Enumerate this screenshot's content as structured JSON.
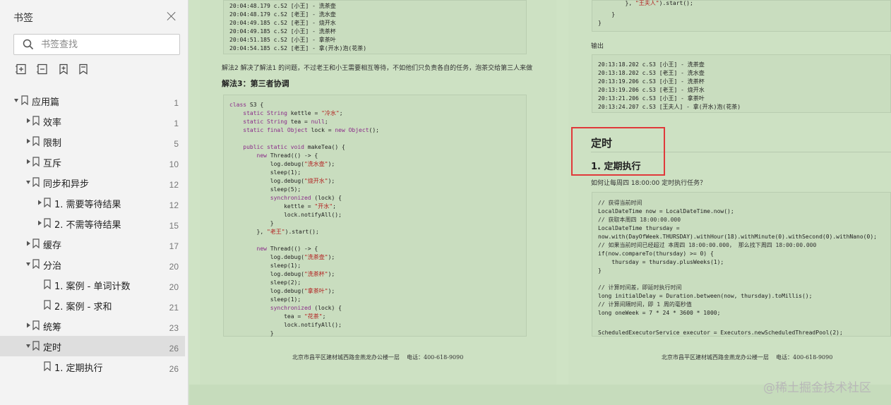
{
  "sidebar": {
    "title": "书签",
    "search_placeholder": "书签查找",
    "items": [
      {
        "label": "应用篇",
        "page": "1"
      },
      {
        "label": "效率",
        "page": "1"
      },
      {
        "label": "限制",
        "page": "5"
      },
      {
        "label": "互斥",
        "page": "10"
      },
      {
        "label": "同步和异步",
        "page": "12"
      },
      {
        "label": "1. 需要等待结果",
        "page": "12"
      },
      {
        "label": "2. 不需等待结果",
        "page": "15"
      },
      {
        "label": "缓存",
        "page": "17"
      },
      {
        "label": "分治",
        "page": "20"
      },
      {
        "label": "1. 案例 - 单词计数",
        "page": "20"
      },
      {
        "label": "2. 案例 - 求和",
        "page": "21"
      },
      {
        "label": "统筹",
        "page": "23"
      },
      {
        "label": "定时",
        "page": "26"
      },
      {
        "label": "1. 定期执行",
        "page": "26"
      }
    ]
  },
  "page_left": {
    "top_log": [
      "20:04:48.179 c.S2 [小王] - 洗茶壶",
      "20:04:48.179 c.S2 [老王] - 洗水壶",
      "20:04:49.185 c.S2 [老王] - 烧开水",
      "20:04:49.185 c.S2 [小王] - 洗茶杯",
      "20:04:51.185 c.S2 [小王] - 拿茶叶",
      "20:04:54.185 c.S2 [老王] - 拿(开水)泡(花茶)"
    ],
    "paragraph": "解法2 解决了解法1 的问题，不过老王和小王需要相互等待，不如他们只负责各自的任务，泡茶交给第三人来做",
    "heading": "解法3：第三者协调",
    "footer_address": "北京市昌平区建材城西路金燕龙办公楼一层",
    "footer_phone": "电话：400-618-9090"
  },
  "page_right": {
    "output_label": "输出",
    "output_log": [
      "20:13:18.202 c.S3 [小王] - 洗茶壶",
      "20:13:18.202 c.S3 [老王] - 洗水壶",
      "20:13:19.206 c.S3 [小王] - 洗茶杯",
      "20:13:19.206 c.S3 [老王] - 烧开水",
      "20:13:21.206 c.S3 [小王] - 拿茶叶",
      "20:13:24.207 c.S3 [王夫人] - 拿(开水)泡(花茶)"
    ],
    "section_title": "定时",
    "subsection_title": "1. 定期执行",
    "question": "如何让每周四 18:00:00 定时执行任务？",
    "footer_address": "北京市昌平区建材城西路金燕龙办公楼一层",
    "footer_phone": "电话：400-618-9090"
  },
  "watermark": "@稀土掘金技术社区"
}
